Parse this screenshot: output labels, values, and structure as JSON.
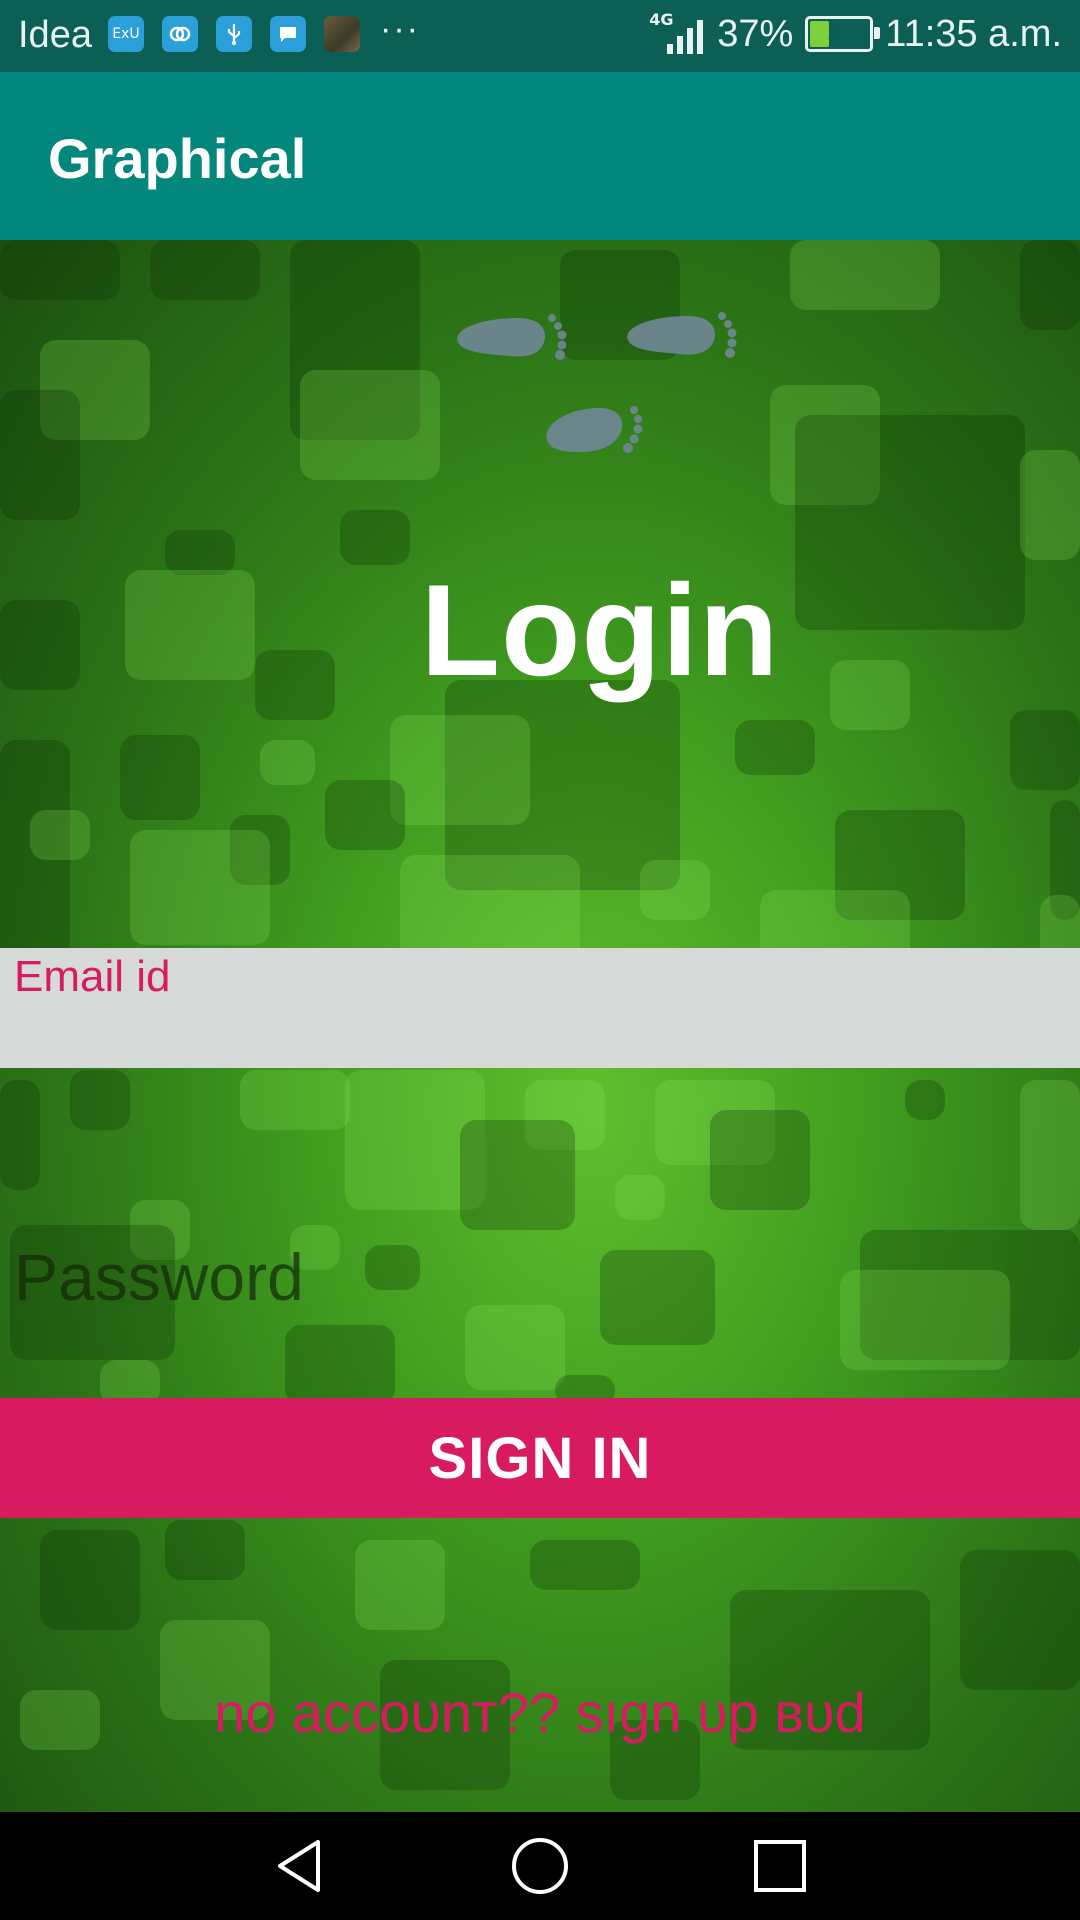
{
  "status_bar": {
    "carrier": "Idea",
    "notification_icons": [
      "exu-icon",
      "link-icon",
      "usb-icon",
      "message-icon",
      "photo-icon"
    ],
    "more_indicator": "···",
    "network": "4G",
    "battery_percent": "37%",
    "battery_level": 0.37,
    "charging": true,
    "time": "11:35 a.m."
  },
  "app_bar": {
    "title": "Graphical"
  },
  "login": {
    "heading": "Login",
    "email_label": "Email id",
    "password_placeholder": "Password",
    "signin_label": "SIGN IN",
    "signup_text": "no accoᴜnт?? sıgn ᴜp вᴜd"
  },
  "colors": {
    "status_bar": "#0b5f55",
    "app_bar": "#03867b",
    "accent": "#d81b60",
    "field_bg": "#d6dbda",
    "footprint": "#6f8794"
  },
  "nav_bar": {
    "buttons": [
      "back-icon",
      "home-icon",
      "recents-icon"
    ]
  }
}
